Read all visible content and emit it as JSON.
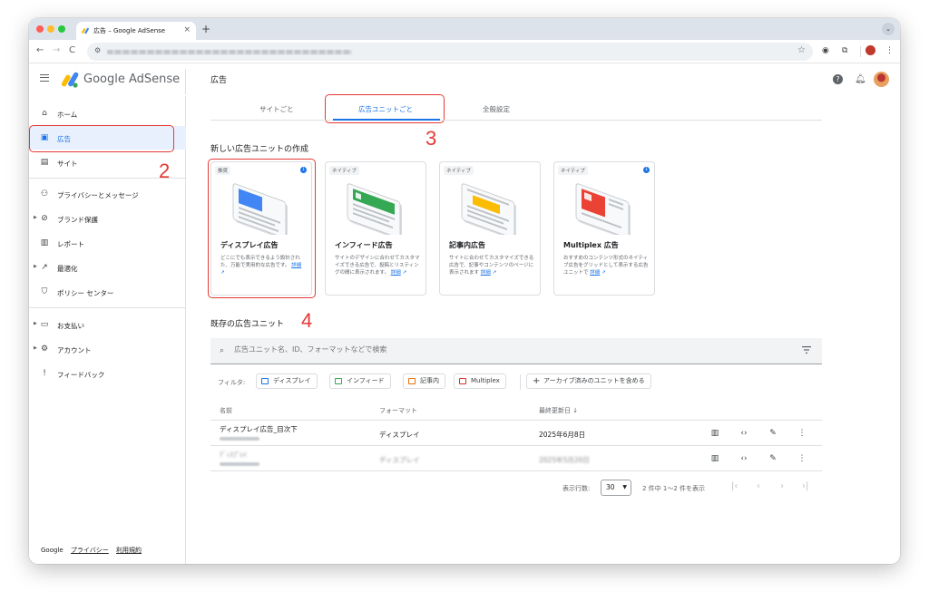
{
  "browser": {
    "tab_title": "広告 – Google AdSense",
    "new_tab": "+",
    "close": "×",
    "nav": {
      "back": "←",
      "forward": "→",
      "reload": "C"
    }
  },
  "app": {
    "brand": "Google AdSense",
    "page_title": "広告"
  },
  "sidebar": {
    "items": [
      {
        "label": "ホーム",
        "icon": "home-icon"
      },
      {
        "label": "広告",
        "icon": "ads-icon"
      },
      {
        "label": "サイト",
        "icon": "sites-icon"
      },
      {
        "label": "プライバシーとメッセージ",
        "icon": "privacy-icon"
      },
      {
        "label": "ブランド保護",
        "icon": "block-icon"
      },
      {
        "label": "レポート",
        "icon": "report-icon"
      },
      {
        "label": "最適化",
        "icon": "trend-icon"
      },
      {
        "label": "ポリシー センター",
        "icon": "shield-icon"
      },
      {
        "label": "お支払い",
        "icon": "payments-icon"
      },
      {
        "label": "アカウント",
        "icon": "gear-icon"
      },
      {
        "label": "フィードバック",
        "icon": "feedback-icon"
      }
    ],
    "footer": {
      "google": "Google",
      "privacy": "プライバシー",
      "terms": "利用規約"
    }
  },
  "annotations": {
    "n2": "2",
    "n3": "3",
    "n4": "4"
  },
  "tabs": [
    {
      "label": "サイトごと"
    },
    {
      "label": "広告ユニットごと"
    },
    {
      "label": "全般設定"
    }
  ],
  "create_section": {
    "title": "新しい広告ユニットの作成",
    "cards": [
      {
        "tag": "推奨",
        "title": "ディスプレイ広告",
        "desc": "どこにでも表示できるよう設計された、万能で実用的な広告です。",
        "more": "詳細",
        "color": "#4285f4"
      },
      {
        "tag": "ネイティブ",
        "title": "インフィード広告",
        "desc": "サイトのデザインに合わせてカスタマイズできる広告で、投稿とリスティングの間に表示されます。",
        "more": "詳細",
        "color": "#34a853"
      },
      {
        "tag": "ネイティブ",
        "title": "記事内広告",
        "desc": "サイトに合わせてカスタマイズできる広告で、記事やコンテンツのページに表示されます",
        "more": "詳細",
        "color": "#fbbc04"
      },
      {
        "tag": "ネイティブ",
        "title": "Multiplex 広告",
        "desc": "おすすめのコンテンツ形式のネイティブ広告をグリッドとして表示する広告ユニットで",
        "more": "詳細",
        "color": "#ea4335"
      }
    ]
  },
  "existing_section": {
    "title": "既存の広告ユニット",
    "search_placeholder": "広告ユニット名、ID、フォーマットなどで検索",
    "filter_label": "フィルタ:",
    "filters": [
      {
        "label": "ディスプレイ",
        "color": "#1a73e8"
      },
      {
        "label": "インフィード",
        "color": "#34a853"
      },
      {
        "label": "記事内",
        "color": "#e8710a"
      },
      {
        "label": "Multiplex",
        "color": "#d93025"
      }
    ],
    "archive_label": "アーカイブ済みのユニットを含める",
    "columns": {
      "name": "名前",
      "format": "フォーマット",
      "updated": "最終更新日 ↓"
    },
    "rows": [
      {
        "name": "ディスプレイ広告_目次下",
        "format": "ディスプレイ",
        "updated": "2025年6月8日"
      },
      {
        "name": "ﾃﾞｨｽﾌﾟﾚｲ",
        "format": "ディスプレイ",
        "updated": "2025年5月20日"
      }
    ],
    "pager": {
      "rows_label": "表示行数:",
      "rows_value": "30",
      "range": "2 件中 1～2 件を表示"
    }
  }
}
